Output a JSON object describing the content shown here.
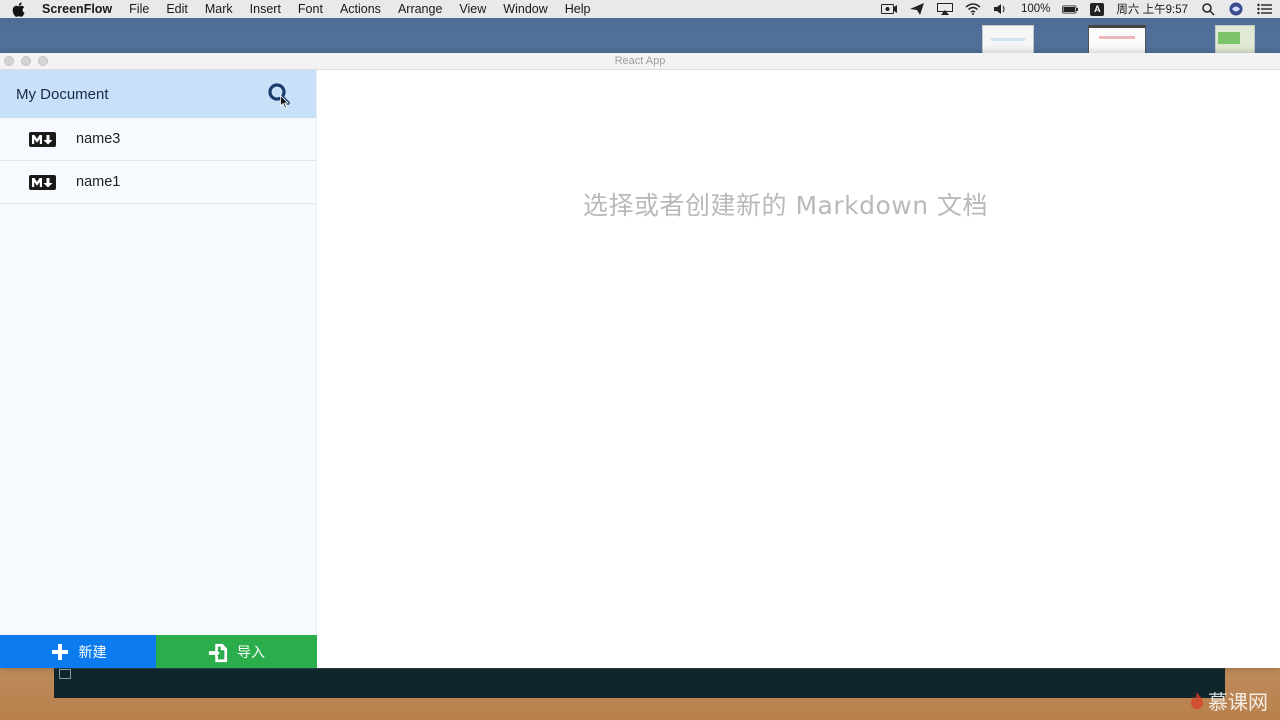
{
  "menubar": {
    "app_name": "ScreenFlow",
    "items": [
      "File",
      "Edit",
      "Mark",
      "Insert",
      "Font",
      "Actions",
      "Arrange",
      "View",
      "Window",
      "Help"
    ],
    "battery": "100%",
    "input_method": "A",
    "clock": "周六 上午9:57"
  },
  "window": {
    "title": "React App"
  },
  "sidebar": {
    "header_title": "My Document",
    "files": [
      {
        "name": "name3",
        "icon": "markdown-icon"
      },
      {
        "name": "name1",
        "icon": "markdown-icon"
      }
    ],
    "buttons": {
      "new_label": "新建",
      "import_label": "导入"
    }
  },
  "main": {
    "placeholder": "选择或者创建新的 Markdown 文档"
  },
  "watermark": {
    "text": "慕课网"
  },
  "colors": {
    "header_bg": "#c8e0f8",
    "new_button": "#0d7bf0",
    "import_button": "#2aad4a",
    "search_icon": "#1d3a6e"
  }
}
